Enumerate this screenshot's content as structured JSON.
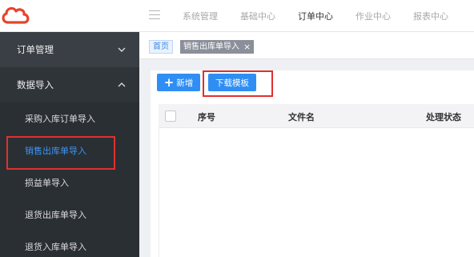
{
  "top_nav": {
    "items": [
      {
        "label": "系统管理",
        "active": false
      },
      {
        "label": "基础中心",
        "active": false
      },
      {
        "label": "订单中心",
        "active": true
      },
      {
        "label": "作业中心",
        "active": false
      },
      {
        "label": "报表中心",
        "active": false
      }
    ]
  },
  "sidebar": {
    "groups": [
      {
        "label": "订单管理",
        "expanded": false
      },
      {
        "label": "数据导入",
        "expanded": true
      }
    ],
    "items": [
      {
        "label": "采购入库订单导入",
        "active": false
      },
      {
        "label": "销售出库单导入",
        "active": true
      },
      {
        "label": "损益单导入",
        "active": false
      },
      {
        "label": "退货出库单导入",
        "active": false
      },
      {
        "label": "退货入库单导入",
        "active": false
      }
    ]
  },
  "tabs": {
    "home": "首页",
    "current": "销售出库单导入",
    "close_glyph": "×"
  },
  "toolbar": {
    "add_icon": "+",
    "add_label": "新增",
    "download_label": "下载模板"
  },
  "table": {
    "columns": [
      "序号",
      "文件名",
      "处理状态"
    ],
    "rows": []
  },
  "colors": {
    "accent": "#2f8ef4",
    "sidebar_bg": "#2f3439",
    "active_item": "#3b95f3",
    "highlight": "#e0302e"
  },
  "icons": {
    "logo": "cloud-logo-icon",
    "menu": "hamburger-icon",
    "collapse": "chevron-down-icon",
    "expand": "chevron-up-icon",
    "add": "plus-icon",
    "close": "close-icon"
  }
}
